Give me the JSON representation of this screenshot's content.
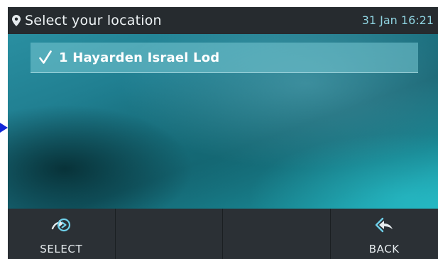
{
  "header": {
    "title": "Select your location",
    "datetime": "31 Jan 16:21",
    "icon": "location-pin-icon"
  },
  "list": {
    "items": [
      {
        "label": "1 Hayarden Israel Lod",
        "selected": true,
        "icon": "checkmark-icon"
      }
    ]
  },
  "softkeys": [
    {
      "label": "SELECT",
      "icon": "select-arrow-icon"
    },
    {
      "label": "",
      "icon": ""
    },
    {
      "label": "",
      "icon": ""
    },
    {
      "label": "BACK",
      "icon": "back-arrow-icon"
    }
  ],
  "colors": {
    "header_bg": "#262b2f",
    "time_color": "#8fd3e0",
    "softkey_bg": "#2b3035",
    "icon_accent": "#6fd0ea",
    "pointer": "#1428d8"
  }
}
